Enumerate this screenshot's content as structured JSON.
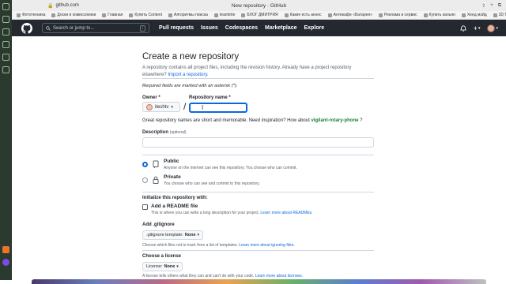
{
  "browser": {
    "url": "github.com",
    "tab_title": "New repository · GitHub",
    "bookmarks": [
      "Фототехника",
      "Доски и комиссионки",
      "Главная",
      "Купить Content",
      "Алгоритмы поиска",
      "teamtrite",
      "БЛОГ ДМИТРИЯ",
      "Какие есть анонс",
      "Антикафе «Батарея»",
      "Реклама в сервис",
      "Купить кальян",
      "Хенд мэйд",
      "3D Печать"
    ],
    "bookmarks_other": "Другое"
  },
  "header": {
    "search_placeholder": "Search or jump to...",
    "search_shortcut": "/",
    "nav": [
      "Pull requests",
      "Issues",
      "Codespaces",
      "Marketplace",
      "Explore"
    ],
    "plus": "+",
    "caret": "▾"
  },
  "page": {
    "title": "Create a new repository",
    "intro": "A repository contains all project files, including the revision history. Already have a project repository elsewhere?",
    "import_link": "Import a repository.",
    "required_note": "Required fields are marked with an asterisk (*).",
    "owner_label": "Owner *",
    "owner_value": "itechtv",
    "owner_caret": "▾",
    "slash": "/",
    "repo_label": "Repository name *",
    "repo_value": "",
    "hint_prefix": "Great repository names are short and memorable. Need inspiration? How about",
    "hint_suggestion": "vigilant-rotary-phone",
    "hint_suffix": "?",
    "description_label": "Description",
    "description_optional": "(optional)",
    "description_value": "",
    "public_title": "Public",
    "public_sub": "Anyone on the internet can see this repository. You choose who can commit.",
    "private_title": "Private",
    "private_sub": "You choose who can see and commit to this repository.",
    "init_heading": "Initialize this repository with:",
    "readme_title": "Add a README file",
    "readme_sub": "This is where you can write a long description for your project.",
    "readme_link": "Learn more about READMEs.",
    "gitignore_heading": "Add .gitignore",
    "gitignore_select_label": ".gitignore template:",
    "gitignore_select_value": "None",
    "gitignore_note": "Choose which files not to track from a list of templates.",
    "gitignore_link": "Learn more about ignoring files.",
    "license_heading": "Choose a license",
    "license_select_label": "License:",
    "license_select_value": "None",
    "license_note": "A license tells others what they can and can't do with your code.",
    "license_link": "Learn more about licenses."
  },
  "colors": {
    "header_bg": "#24292f",
    "link": "#0969da",
    "suggestion": "#1a7f37",
    "focus_border": "#0969da"
  },
  "icons": [
    "github-logo-icon",
    "search-icon",
    "bell-icon",
    "plus-icon",
    "book-icon",
    "lock-icon"
  ]
}
